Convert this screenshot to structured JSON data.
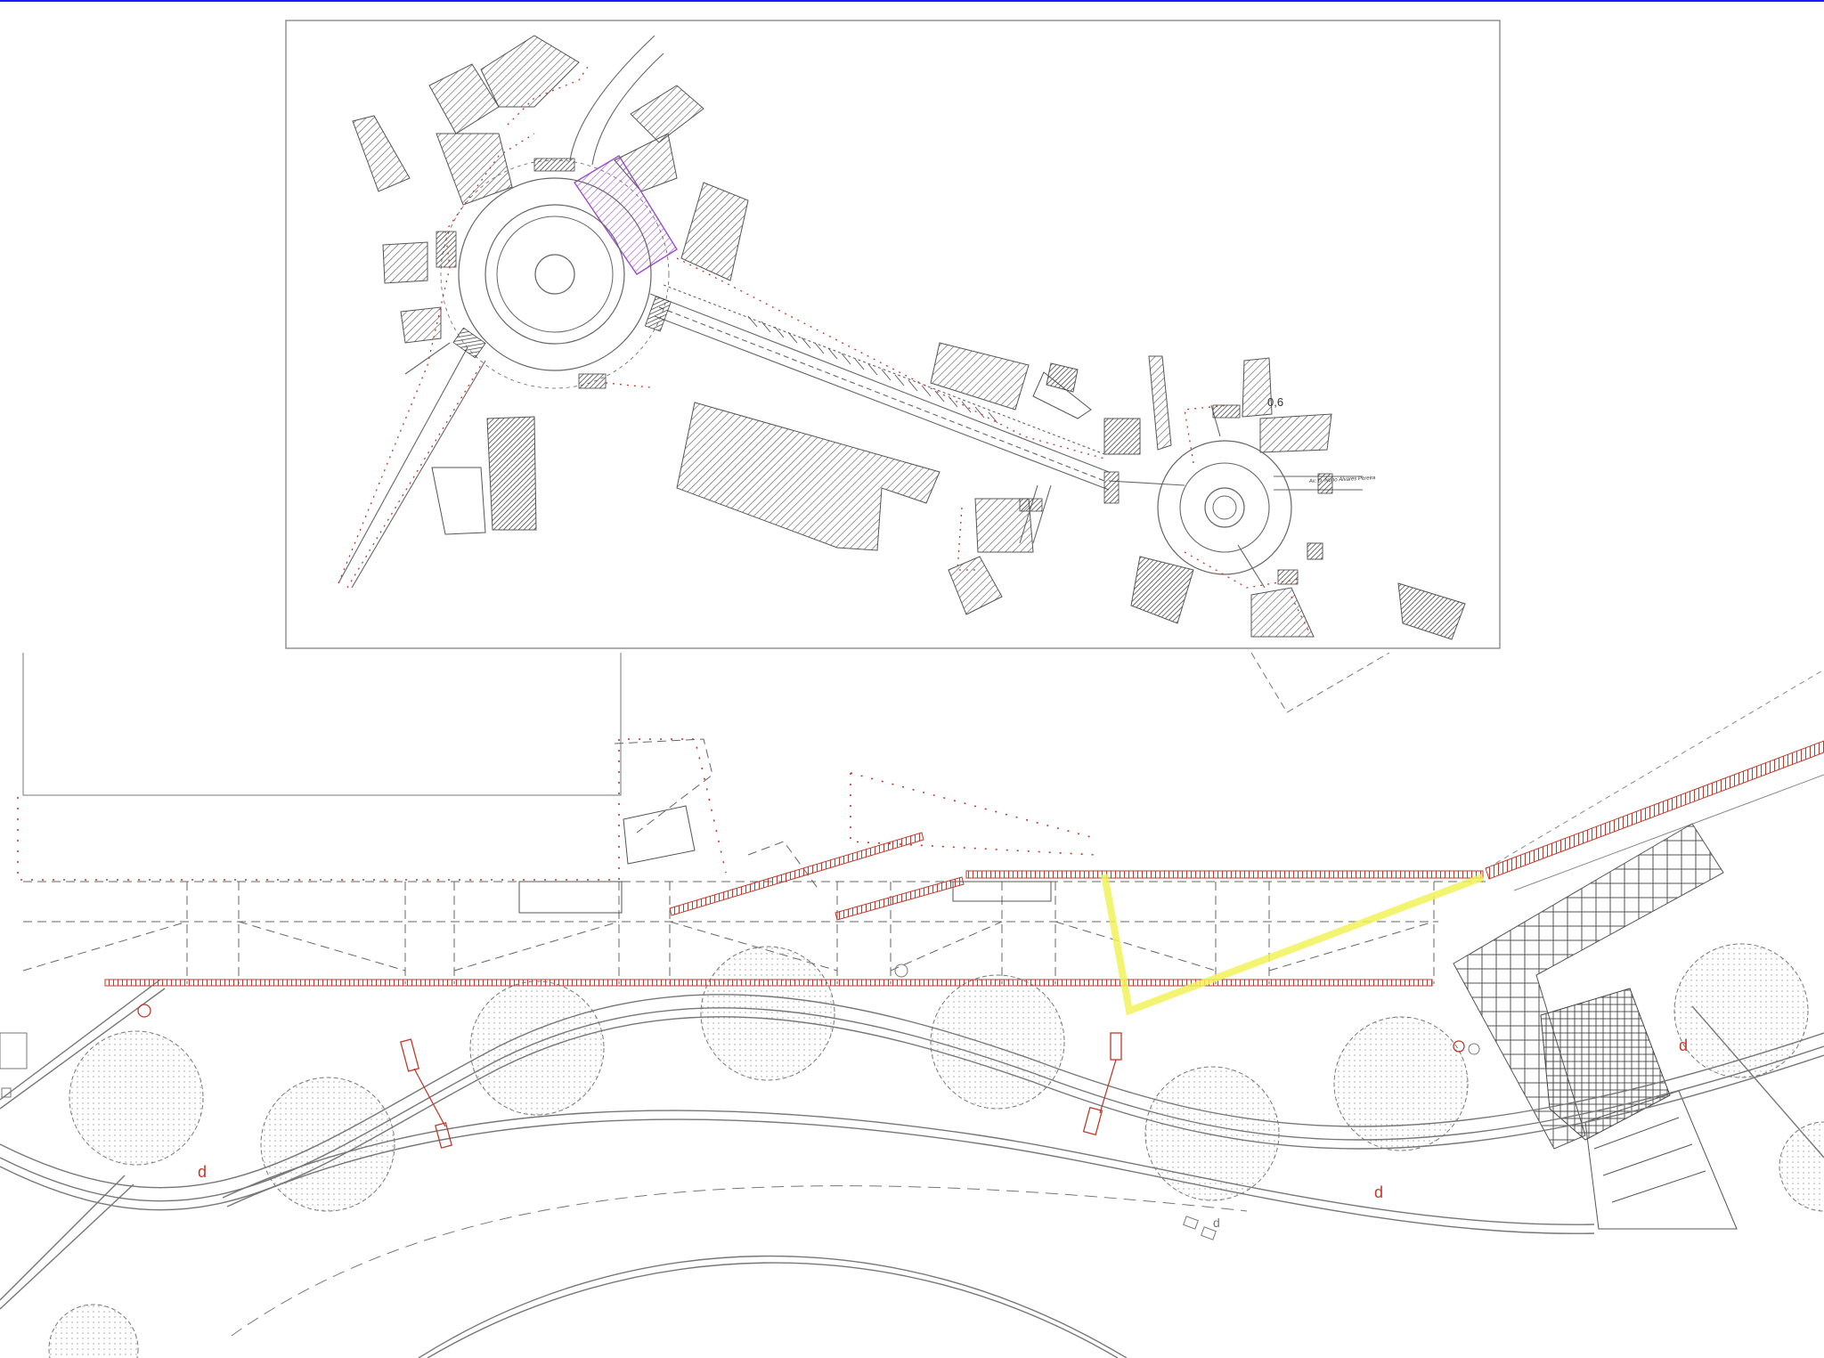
{
  "inset": {
    "labels": {
      "zone": "0,6",
      "street": "Av. D. Nuno Álvares Pereira"
    }
  },
  "detail": {
    "marks": [
      "d",
      "d",
      "d",
      "d"
    ]
  },
  "colors": {
    "frame_top": "#1a1aff",
    "line": "#6e6e6e",
    "dash": "#555555",
    "red": "#c0392b",
    "yellow": "#f2f25a",
    "purple": "#9b4fc9",
    "hatch": "#555555",
    "tree_fill": "#ededed"
  },
  "icons": [
    "north-roundabout-icon",
    "south-roundabout-icon",
    "tree-icon",
    "bollard-icon",
    "paving-grid-icon"
  ]
}
